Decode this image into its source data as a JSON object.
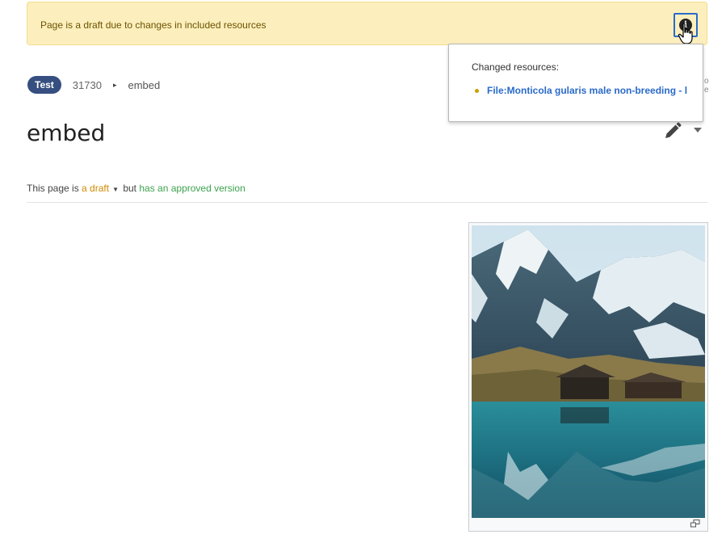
{
  "banner": {
    "message": "Page is a draft due to changes in included resources",
    "info_icon": "info-icon"
  },
  "popup": {
    "title": "Changed resources:",
    "items": [
      "File:Monticola gularis male non-breeding - l"
    ]
  },
  "stray": {
    "line1": "o",
    "line2": "e"
  },
  "breadcrumb": {
    "namespace": "Test",
    "number": "31730",
    "separator": "▸",
    "page": "embed"
  },
  "page": {
    "title": "embed"
  },
  "status": {
    "prefix": "This page is ",
    "draft": "a draft",
    "caret": "▼",
    "middle": " but ",
    "approved": "has an approved version"
  },
  "colors": {
    "banner_bg": "#fdefbd",
    "link": "#2a6ac9",
    "draft": "#d08a00",
    "approved": "#3ca34d",
    "badge": "#364f80"
  },
  "icons": [
    "info-icon",
    "pencil-icon",
    "chevron-down-icon",
    "magnify-icon",
    "hand-cursor-icon"
  ]
}
